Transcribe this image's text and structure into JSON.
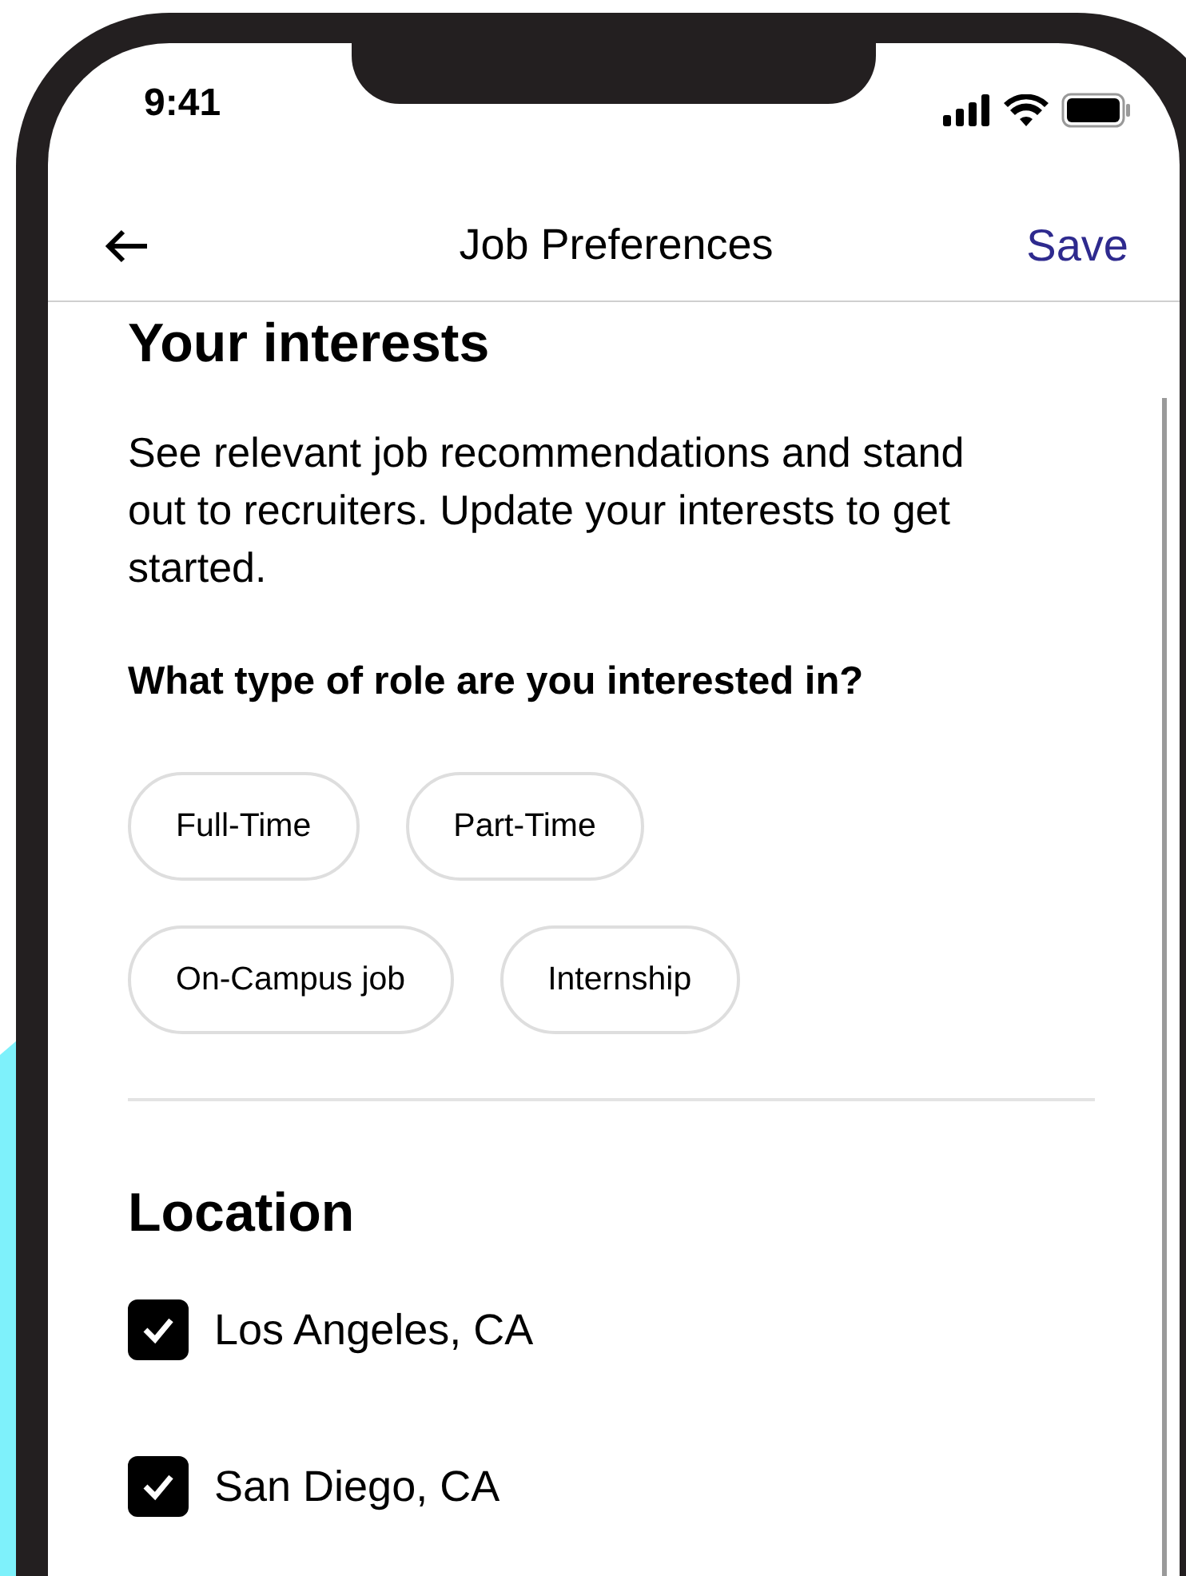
{
  "status_bar": {
    "time": "9:41"
  },
  "nav": {
    "title": "Job Preferences",
    "action": "Save"
  },
  "interests": {
    "heading": "Your interests",
    "description": "See relevant job recommendations and stand out to recruiters. Update your interests to get started.",
    "question": "What type of role are you interested in?",
    "roles": [
      {
        "label": "Full-Time",
        "selected": false
      },
      {
        "label": "Part-Time",
        "selected": false
      },
      {
        "label": "On-Campus job",
        "selected": false
      },
      {
        "label": "Internship",
        "selected": false
      }
    ]
  },
  "location": {
    "heading": "Location",
    "options": [
      {
        "label": "Los Angeles, CA",
        "checked": true
      },
      {
        "label": "San Diego, CA",
        "checked": true
      }
    ]
  }
}
